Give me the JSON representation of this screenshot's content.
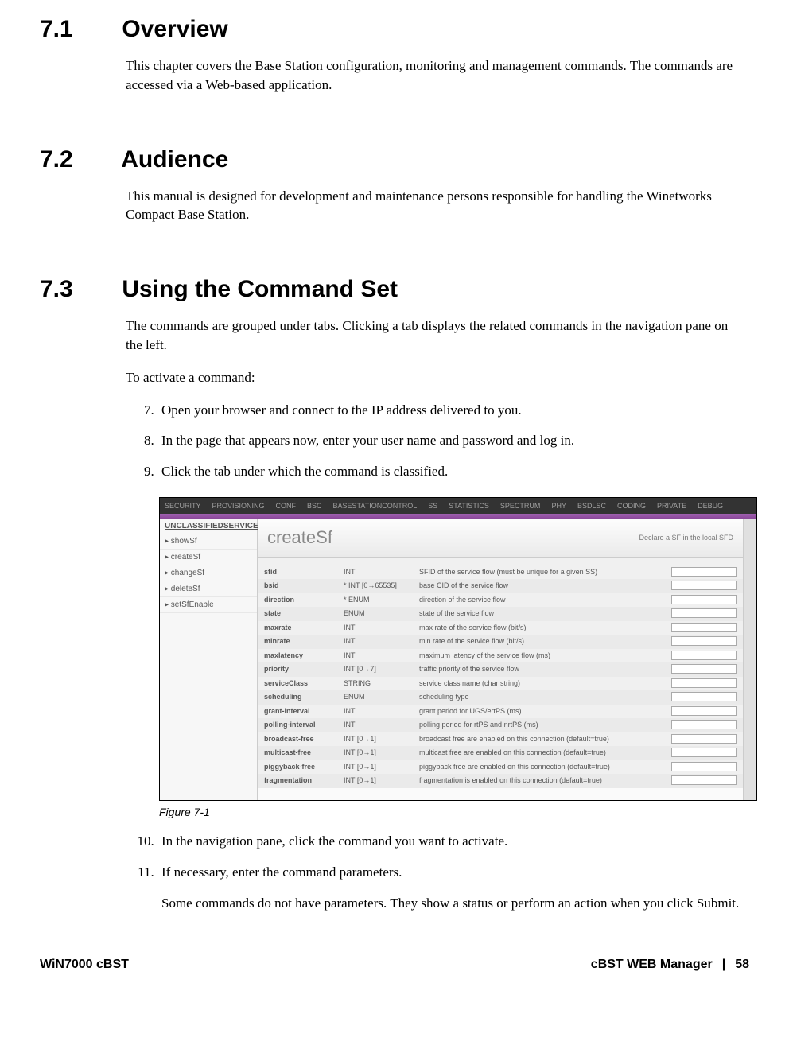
{
  "sections": {
    "s1": {
      "num": "7.1",
      "title": "Overview"
    },
    "s2": {
      "num": "7.2",
      "title": "Audience"
    },
    "s3": {
      "num": "7.3",
      "title": "Using the Command Set"
    }
  },
  "paragraphs": {
    "overview": "This chapter covers the Base Station configuration, monitoring and management commands. The commands are accessed via a Web-based application.",
    "audience": "This manual is designed for development and maintenance persons responsible for handling the Winetworks Compact Base Station.",
    "using1": "The commands are grouped under tabs. Clicking a tab displays the related commands in the navigation pane on the left.",
    "using2": "To activate a command:",
    "note": "Some commands do not have parameters. They show a status or perform an action when you click Submit."
  },
  "steps": {
    "s7": "Open your browser and connect to the IP address delivered to you.",
    "s8": "In the page that appears now, enter your user name and password and log in.",
    "s9": "Click the tab under which the command is classified.",
    "s10": "In the navigation pane, click the command you want to activate.",
    "s11": "If necessary, enter the command parameters."
  },
  "figure": {
    "caption": "Figure 7-1",
    "tabs": [
      "SECURITY",
      "PROVISIONING",
      "CONF",
      "BSC",
      "BASESTATIONCONTROL",
      "SS",
      "STATISTICS",
      "SPECTRUM",
      "PHY",
      "BSDLSC",
      "CODING",
      "PRIVATE",
      "DEBUG"
    ],
    "nav": {
      "title": "UNCLASSIFIEDSERVICEFLOW",
      "items": [
        "▸ showSf",
        "▸ createSf",
        "▸ changeSf",
        "▸ deleteSf",
        "▸ setSfEnable"
      ]
    },
    "panel": {
      "title": "createSf",
      "desc": "Declare a SF in the local SFD"
    },
    "params": [
      {
        "name": "sfid",
        "type": "INT",
        "desc": "SFID of the service flow (must be unique for a given SS)"
      },
      {
        "name": "bsid",
        "type": "* INT [0→65535]",
        "desc": "base CID of the service flow"
      },
      {
        "name": "direction",
        "type": "* ENUM",
        "desc": "direction of the service flow"
      },
      {
        "name": "state",
        "type": "ENUM",
        "desc": "state of the service flow"
      },
      {
        "name": "maxrate",
        "type": "INT",
        "desc": "max rate of the service flow (bit/s)"
      },
      {
        "name": "minrate",
        "type": "INT",
        "desc": "min rate of the service flow (bit/s)"
      },
      {
        "name": "maxlatency",
        "type": "INT",
        "desc": "maximum latency of the service flow (ms)"
      },
      {
        "name": "priority",
        "type": "INT [0→7]",
        "desc": "traffic priority of the service flow"
      },
      {
        "name": "serviceClass",
        "type": "STRING",
        "desc": "service class name (char string)"
      },
      {
        "name": "scheduling",
        "type": "ENUM",
        "desc": "scheduling type"
      },
      {
        "name": "grant-interval",
        "type": "INT",
        "desc": "grant period for UGS/ertPS (ms)"
      },
      {
        "name": "polling-interval",
        "type": "INT",
        "desc": "polling period for rtPS and nrtPS (ms)"
      },
      {
        "name": "broadcast-free",
        "type": "INT [0→1]",
        "desc": "broadcast free are enabled on this connection (default=true)"
      },
      {
        "name": "multicast-free",
        "type": "INT [0→1]",
        "desc": "multicast free are enabled on this connection (default=true)"
      },
      {
        "name": "piggyback-free",
        "type": "INT [0→1]",
        "desc": "piggyback free are enabled on this connection (default=true)"
      },
      {
        "name": "fragmentation",
        "type": "INT [0→1]",
        "desc": "fragmentation is enabled on this connection (default=true)"
      }
    ]
  },
  "footer": {
    "left": "WiN7000 cBST",
    "right_title": "cBST WEB Manager",
    "sep": "|",
    "page": "58"
  }
}
